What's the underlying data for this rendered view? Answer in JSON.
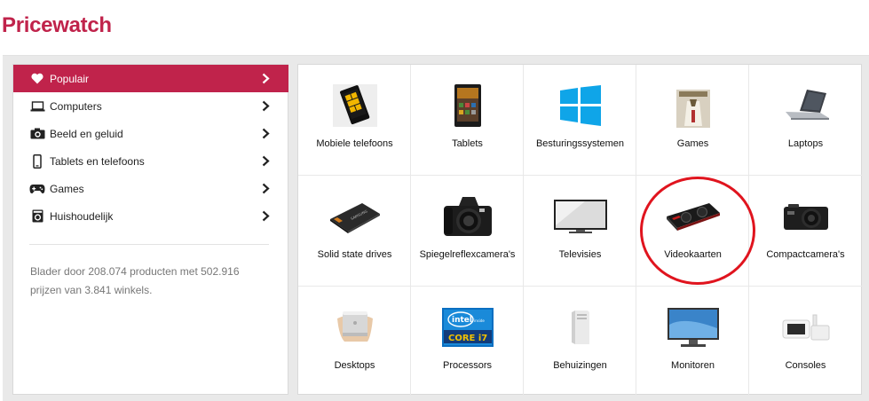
{
  "header": {
    "title": "Pricewatch"
  },
  "sidebar": {
    "items": [
      {
        "label": "Populair",
        "icon": "heart-icon",
        "active": true
      },
      {
        "label": "Computers",
        "icon": "laptop-icon",
        "active": false
      },
      {
        "label": "Beeld en geluid",
        "icon": "camera-icon",
        "active": false
      },
      {
        "label": "Tablets en telefoons",
        "icon": "phone-icon",
        "active": false
      },
      {
        "label": "Games",
        "icon": "gamepad-icon",
        "active": false
      },
      {
        "label": "Huishoudelijk",
        "icon": "washing-machine-icon",
        "active": false
      }
    ],
    "stats_text": "Blader door 208.074 producten met 502.916 prijzen van 3.841 winkels."
  },
  "categories": [
    {
      "label": "Mobiele telefoons",
      "icon": "mobile-phone-icon"
    },
    {
      "label": "Tablets",
      "icon": "tablet-icon"
    },
    {
      "label": "Besturingssystemen",
      "icon": "windows-logo-icon"
    },
    {
      "label": "Games",
      "icon": "game-box-icon"
    },
    {
      "label": "Laptops",
      "icon": "laptop-icon"
    },
    {
      "label": "Solid state drives",
      "icon": "ssd-icon"
    },
    {
      "label": "Spiegelreflexcamera's",
      "icon": "dslr-camera-icon"
    },
    {
      "label": "Televisies",
      "icon": "television-icon"
    },
    {
      "label": "Videokaarten",
      "icon": "graphics-card-icon"
    },
    {
      "label": "Compactcamera's",
      "icon": "compact-camera-icon"
    },
    {
      "label": "Desktops",
      "icon": "desktop-icon"
    },
    {
      "label": "Processors",
      "icon": "cpu-badge-icon"
    },
    {
      "label": "Behuizingen",
      "icon": "pc-case-icon"
    },
    {
      "label": "Monitoren",
      "icon": "monitor-icon"
    },
    {
      "label": "Consoles",
      "icon": "console-icon"
    }
  ],
  "colors": {
    "brand": "#c0234b",
    "highlight": "#e0141e"
  }
}
